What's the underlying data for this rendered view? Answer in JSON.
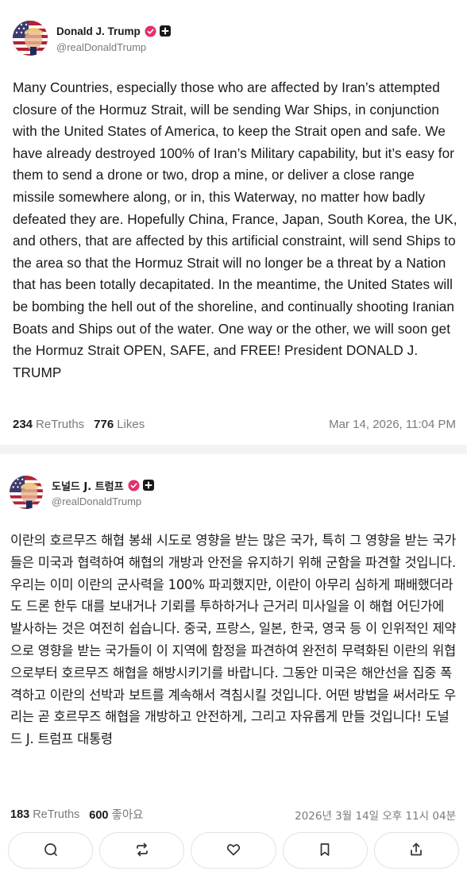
{
  "posts": [
    {
      "author": {
        "name": "Donald J. Trump",
        "handle": "@realDonaldTrump"
      },
      "body": "Many Countries, especially those who are affected by Iran’s attempted closure of the Hormuz Strait, will be sending War Ships, in conjunction with the United States of America, to keep the Strait open and safe. We have already destroyed 100% of Iran’s Military capability, but it’s easy for them to send a drone or two, drop a mine, or deliver a close range missile somewhere along, or in, this Waterway, no matter how badly defeated they are. Hopefully China, France, Japan, South Korea, the UK, and others, that are affected by this artificial constraint, will send Ships to the area so that the Hormuz Strait will no longer be a threat by a Nation that has been totally decapitated. In the meantime, the United States will be bombing the hell out of the shoreline, and continually shooting Iranian Boats and Ships out of the water. One way or the other, we will soon get the Hormuz Strait OPEN, SAFE, and FREE! President DONALD J. TRUMP",
      "retruths_count": "234",
      "retruths_label": "ReTruths",
      "likes_count": "776",
      "likes_label": "Likes",
      "timestamp": "Mar 14, 2026, 11:04 PM"
    },
    {
      "author": {
        "name": "도널드 J. 트럼프",
        "handle": "@realDonaldTrump"
      },
      "body": "이란의 호르무즈 해협 봉쇄 시도로 영향을 받는 많은 국가, 특히 그 영향을 받는 국가들은 미국과 협력하여 해협의 개방과 안전을 유지하기 위해 군함을 파견할 것입니다. 우리는 이미 이란의 군사력을 100% 파괴했지만, 이란이 아무리 심하게 패배했더라도 드론 한두 대를 보내거나 기뢰를 투하하거나 근거리 미사일을 이 해협 어딘가에 발사하는 것은 여전히 쉽습니다. 중국, 프랑스, 일본, 한국, 영국 등 이 인위적인 제약으로 영향을 받는 국가들이 이 지역에 함정을 파견하여 완전히 무력화된 이란의 위협으로부터 호르무즈 해협을 해방시키기를 바랍니다. 그동안 미국은 해안선을 집중 폭격하고 이란의 선박과 보트를 계속해서 격침시킬 것입니다. 어떤 방법을 써서라도 우리는 곧 호르무즈 해협을 개방하고 안전하게, 그리고 자유롭게 만들 것입니다! 도널드 J. 트럼프 대통령",
      "retruths_count": "183",
      "retruths_label": "ReTruths",
      "likes_count": "600",
      "likes_label": "좋아요",
      "timestamp": "2026년 3월 14일 오후 11시 04분"
    }
  ],
  "actions": [
    {
      "icon": "reply-icon"
    },
    {
      "icon": "retruth-icon"
    },
    {
      "icon": "heart-icon"
    },
    {
      "icon": "bookmark-icon"
    },
    {
      "icon": "share-icon"
    }
  ],
  "colors": {
    "verified": "#e1306c",
    "muted_text": "#7a7a7a",
    "body_text": "#1a1a1a",
    "border": "#e3e3e6"
  }
}
